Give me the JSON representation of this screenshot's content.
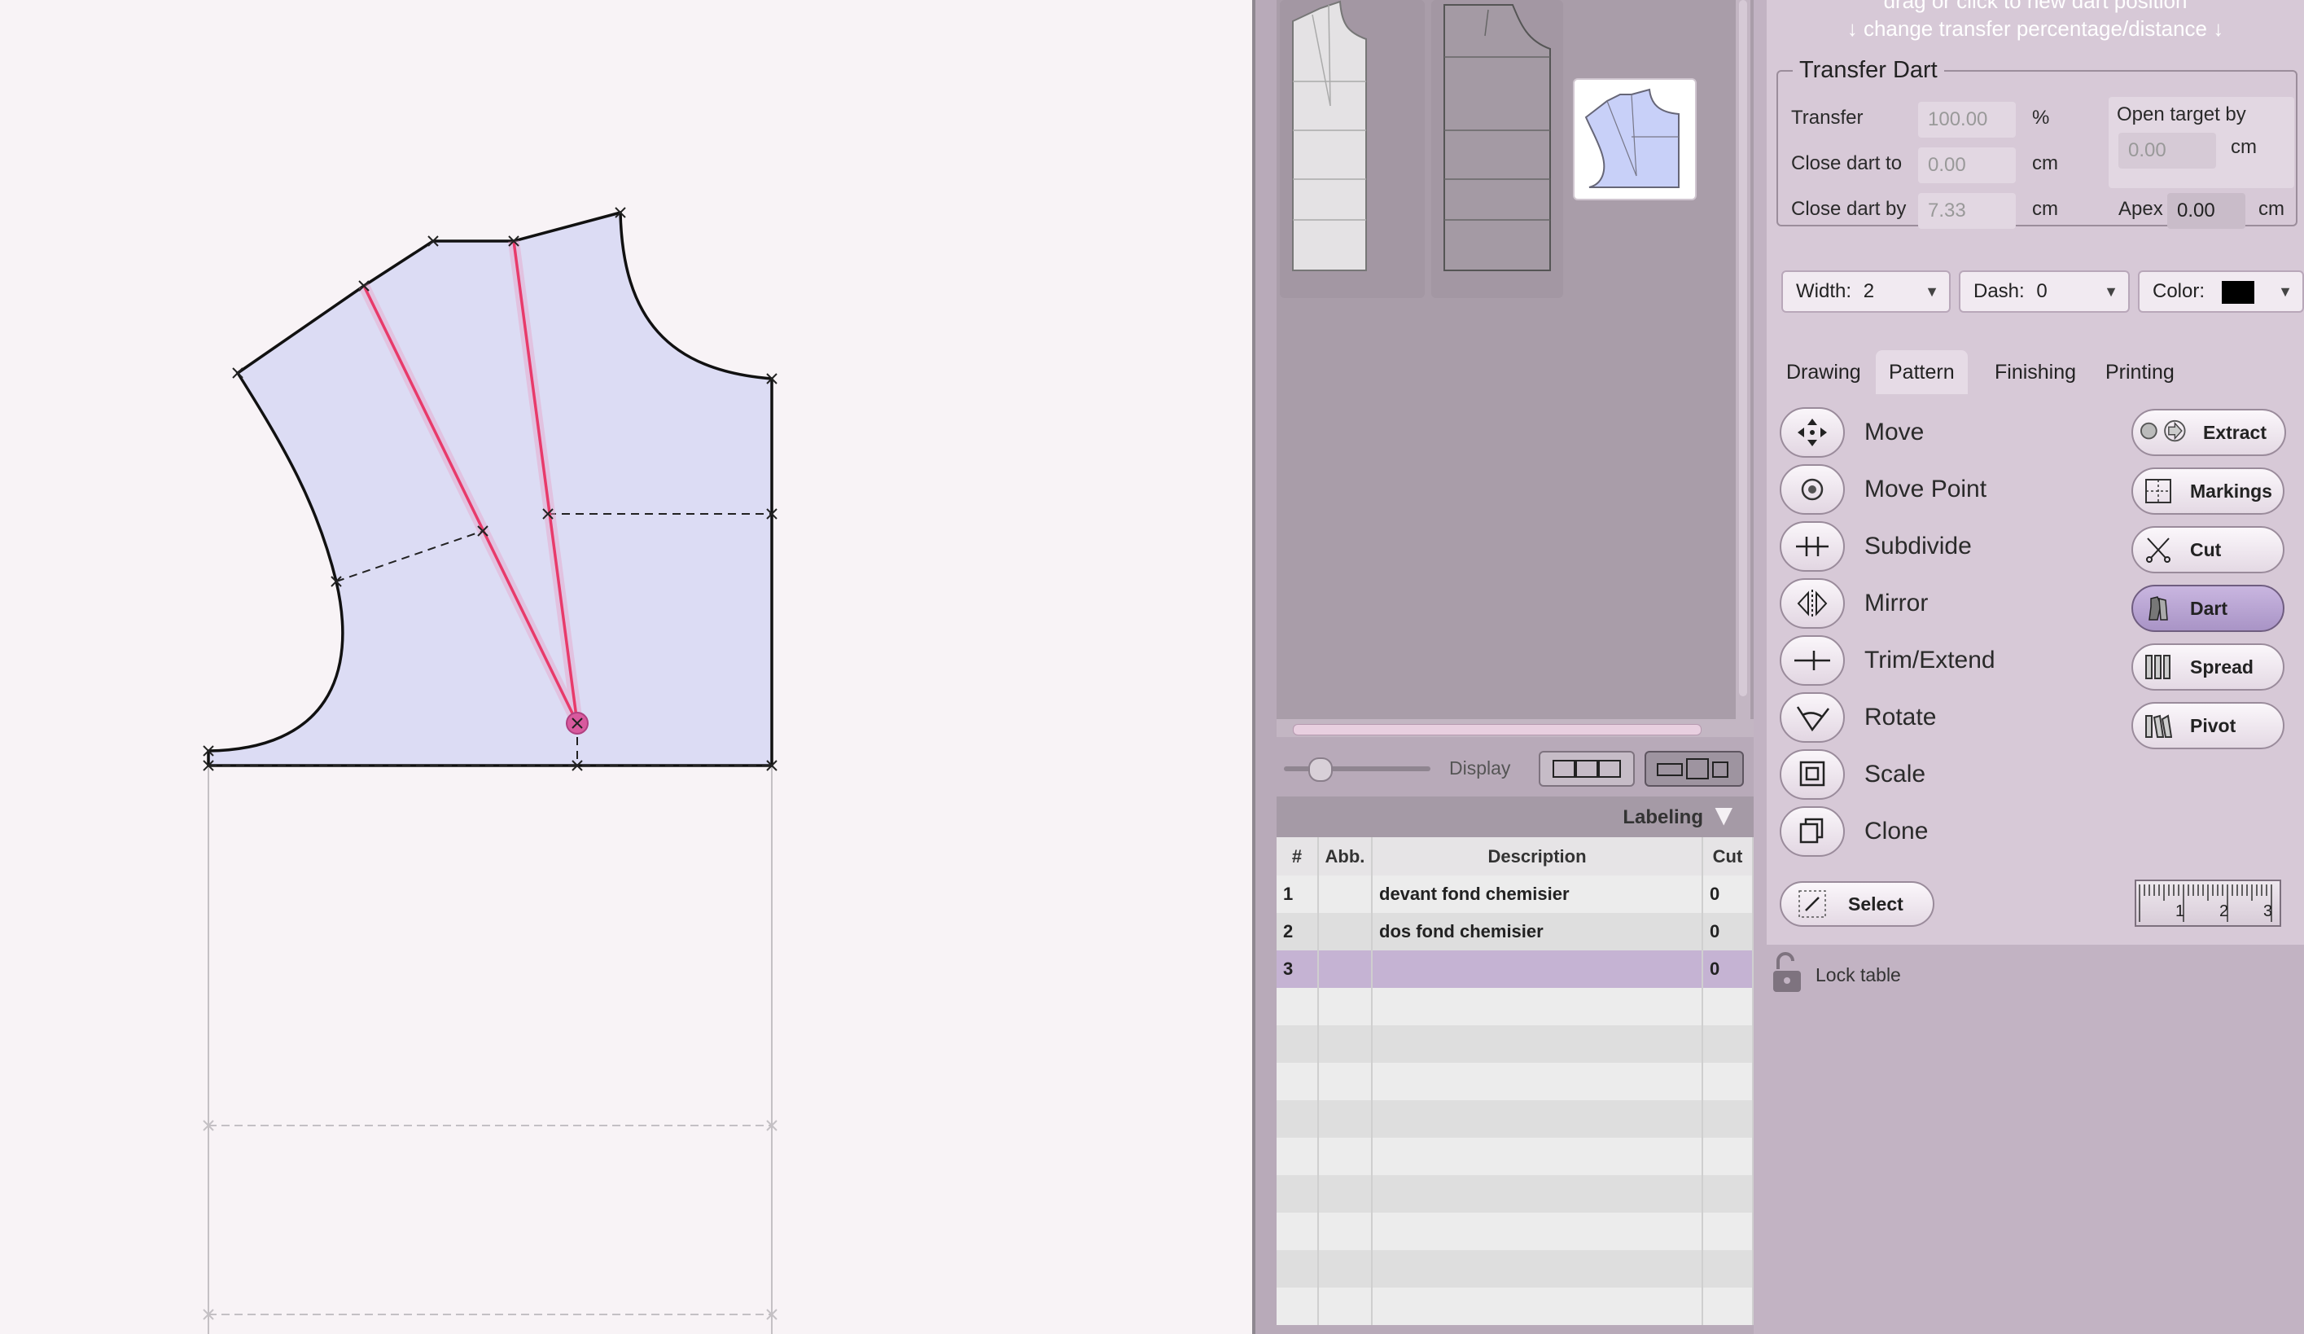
{
  "hints": {
    "line1": "drag or click to new dart position",
    "line2": "↓ change transfer percentage/distance ↓"
  },
  "transfer_dart": {
    "title": "Transfer Dart",
    "transfer_label": "Transfer",
    "transfer_value": "100.00",
    "transfer_unit": "%",
    "close_to_label": "Close dart to",
    "close_to_value": "0.00",
    "close_to_unit": "cm",
    "close_by_label": "Close dart by",
    "close_by_value": "7.33",
    "close_by_unit": "cm",
    "open_target_label": "Open target by",
    "open_target_value": "0.00",
    "open_target_unit": "cm",
    "apex_label": "Apex",
    "apex_value": "0.00",
    "apex_unit": "cm"
  },
  "line_style": {
    "width_label": "Width:",
    "width_value": "2",
    "dash_label": "Dash:",
    "dash_value": "0",
    "color_label": "Color:",
    "color_value": "#000000"
  },
  "tabs": [
    "Drawing",
    "Pattern",
    "Finishing",
    "Printing"
  ],
  "active_tab": "Pattern",
  "tools_left": [
    {
      "label": "Move",
      "icon": "move-arrows-icon"
    },
    {
      "label": "Move Point",
      "icon": "target-icon"
    },
    {
      "label": "Subdivide",
      "icon": "subdivide-icon"
    },
    {
      "label": "Mirror",
      "icon": "mirror-icon"
    },
    {
      "label": "Trim/Extend",
      "icon": "trim-extend-icon"
    },
    {
      "label": "Rotate",
      "icon": "rotate-icon"
    },
    {
      "label": "Scale",
      "icon": "scale-icon"
    },
    {
      "label": "Clone",
      "icon": "clone-icon"
    }
  ],
  "tools_right": [
    {
      "label": "Extract",
      "icon": "extract-icon"
    },
    {
      "label": "Markings",
      "icon": "markings-icon"
    },
    {
      "label": "Cut",
      "icon": "scissors-icon"
    },
    {
      "label": "Dart",
      "icon": "dart-icon",
      "active": true
    },
    {
      "label": "Spread",
      "icon": "spread-icon"
    },
    {
      "label": "Pivot",
      "icon": "pivot-icon"
    }
  ],
  "select_label": "Select",
  "ruler_ticks": [
    "1",
    "2",
    "3"
  ],
  "lock_label": "Lock table",
  "display_label": "Display",
  "display_slider_fraction": 0.18,
  "labeling_label": "Labeling",
  "table": {
    "headers": [
      "#",
      "Abb.",
      "Description",
      "Cut"
    ],
    "rows": [
      [
        "1",
        "",
        "devant fond chemisier",
        "0"
      ],
      [
        "2",
        "",
        "dos fond chemisier",
        "0"
      ],
      [
        "3",
        "",
        "",
        "0"
      ]
    ]
  },
  "colors": {
    "piece_fill": "#dcdcf4",
    "dart_line": "#e83a6a",
    "selected_row": "#c5b3d3",
    "panel": "#d7c9d7",
    "active_tool": "#b9a3d3"
  }
}
